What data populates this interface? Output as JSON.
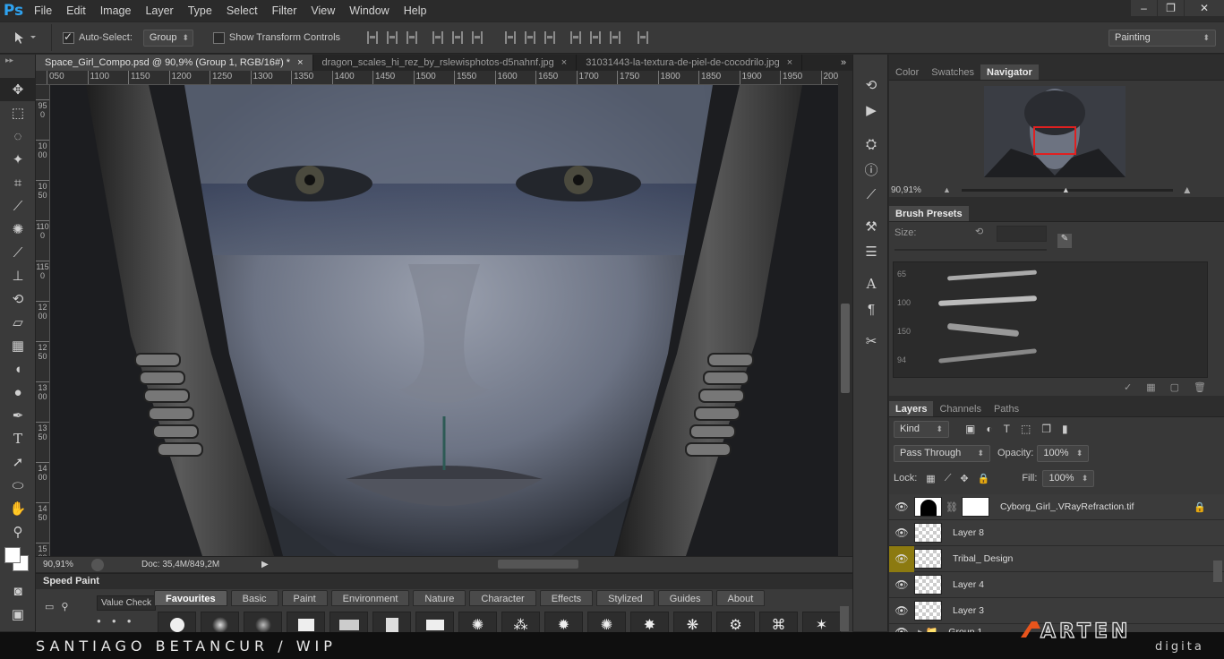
{
  "menubar": {
    "logo": "Ps",
    "items": [
      "File",
      "Edit",
      "Image",
      "Layer",
      "Type",
      "Select",
      "Filter",
      "View",
      "Window",
      "Help"
    ],
    "window_controls": [
      "–",
      "❐",
      "✕"
    ]
  },
  "options": {
    "auto_select_label": "Auto-Select:",
    "auto_select_value": "Group",
    "show_transform_label": "Show Transform Controls",
    "workspace": "Painting"
  },
  "tabs": [
    {
      "label": "Space_Girl_Compo.psd @ 90,9% (Group 1, RGB/16#) *",
      "close": "×",
      "active": true
    },
    {
      "label": "dragon_scales_hi_rez_by_rslewisphotos-d5nahnf.jpg",
      "close": "×",
      "active": false
    },
    {
      "label": "31031443-la-textura-de-piel-de-cocodrilo.jpg",
      "close": "×",
      "active": false
    }
  ],
  "tab_overflow": "»",
  "ruler_top": [
    "050",
    "1100",
    "1150",
    "1200",
    "1250",
    "1300",
    "1350",
    "1400",
    "1450",
    "1500",
    "1550",
    "1600",
    "1650",
    "1700",
    "1750",
    "1800",
    "1850",
    "1900",
    "1950",
    "2000"
  ],
  "ruler_left": [
    "950",
    "1000",
    "1050",
    "1100",
    "1150",
    "1200",
    "1250",
    "1300",
    "1350",
    "1400",
    "1450",
    "1500"
  ],
  "status": {
    "zoom": "90,91%",
    "doc": "Doc: 35,4M/849,2M"
  },
  "speedpaint": {
    "title": "Speed Paint",
    "value_check": "Value Check",
    "tabs": [
      "Favourites",
      "Basic",
      "Paint",
      "Environment",
      "Nature",
      "Character",
      "Effects",
      "Stylized",
      "Guides",
      "About"
    ]
  },
  "navigator": {
    "tabs": [
      "Color",
      "Swatches",
      "Navigator"
    ],
    "zoom": "90,91%"
  },
  "brush_presets": {
    "title": "Brush Presets",
    "size_label": "Size:",
    "sizes": [
      "65",
      "100",
      "150",
      "94"
    ]
  },
  "layers": {
    "tabs": [
      "Layers",
      "Channels",
      "Paths"
    ],
    "kind_label": "Kind",
    "blend_mode": "Pass Through",
    "opacity_label": "Opacity:",
    "opacity_value": "100%",
    "lock_label": "Lock:",
    "fill_label": "Fill:",
    "fill_value": "100%",
    "items": [
      {
        "name": "Cyborg_Girl_.VRayRefraction.tif",
        "highlight": false
      },
      {
        "name": "Layer 8",
        "highlight": false
      },
      {
        "name": "Tribal_ Design",
        "highlight": true
      },
      {
        "name": "Layer 4",
        "highlight": false
      },
      {
        "name": "Layer 3",
        "highlight": false
      },
      {
        "name": "Group 1",
        "highlight": false
      }
    ]
  },
  "banner": {
    "credit": "SANTIAGO BETANCUR / WIP",
    "logo_word": "ARTEN",
    "logo_sub": "digital"
  },
  "colors": {
    "accent": "#2fa3f0",
    "layer_highlight": "#8c7a10",
    "logo_orange": "#e8541c",
    "nav_frame": "#e02020"
  }
}
